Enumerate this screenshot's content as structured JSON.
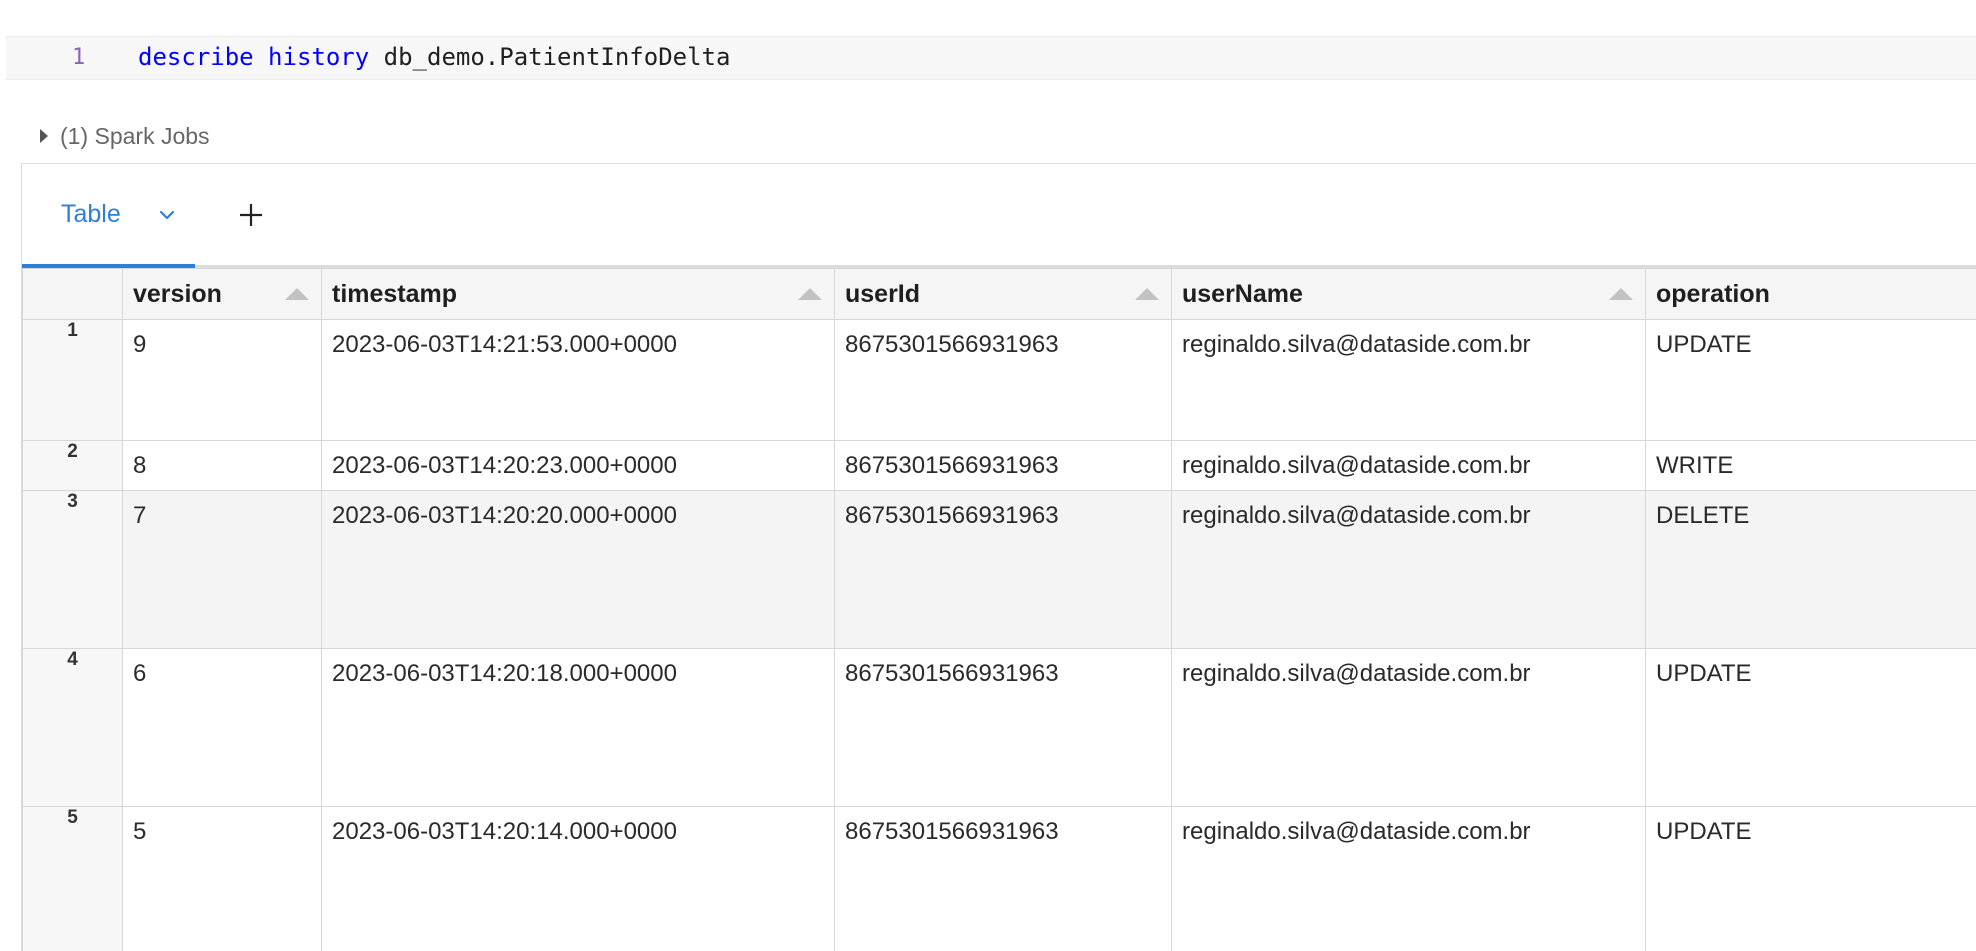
{
  "editor": {
    "line_number": "1",
    "tokens": [
      {
        "text": "describe",
        "kind": "keyword"
      },
      {
        "text": " ",
        "kind": "plain"
      },
      {
        "text": "history",
        "kind": "keyword"
      },
      {
        "text": " db_demo.PatientInfoDelta",
        "kind": "plain"
      }
    ]
  },
  "spark_jobs": {
    "label": "(1) Spark Jobs",
    "caret_icon": "caret-right-icon"
  },
  "result": {
    "tabs": [
      {
        "label": "Table",
        "active": true,
        "dropdown_icon": "chevron-down-icon"
      }
    ],
    "add_tab_icon": "plus-icon",
    "accent_color": "#2d7fd8",
    "columns": [
      "version",
      "timestamp",
      "userId",
      "userName",
      "operation"
    ],
    "rows": [
      {
        "index": "1",
        "cells": [
          "9",
          "2023-06-03T14:21:53.000+0000",
          "8675301566931963",
          "reginaldo.silva@dataside.com.br",
          "UPDATE"
        ]
      },
      {
        "index": "2",
        "cells": [
          "8",
          "2023-06-03T14:20:23.000+0000",
          "8675301566931963",
          "reginaldo.silva@dataside.com.br",
          "WRITE"
        ]
      },
      {
        "index": "3",
        "cells": [
          "7",
          "2023-06-03T14:20:20.000+0000",
          "8675301566931963",
          "reginaldo.silva@dataside.com.br",
          "DELETE"
        ]
      },
      {
        "index": "4",
        "cells": [
          "6",
          "2023-06-03T14:20:18.000+0000",
          "8675301566931963",
          "reginaldo.silva@dataside.com.br",
          "UPDATE"
        ]
      },
      {
        "index": "5",
        "cells": [
          "5",
          "2023-06-03T14:20:14.000+0000",
          "8675301566931963",
          "reginaldo.silva@dataside.com.br",
          "UPDATE"
        ]
      }
    ],
    "striped_row_index": "3"
  }
}
